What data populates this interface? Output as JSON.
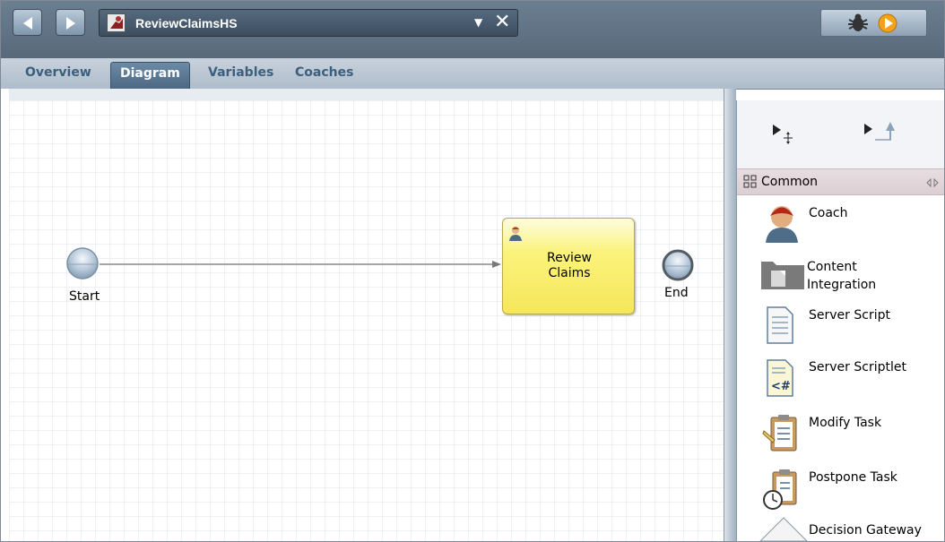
{
  "window": {
    "tab_title": "ReviewClaimsHS",
    "dropdown_glyph": "▼",
    "close_glyph": "✕",
    "back_icon": "arrow-left-icon",
    "forward_icon": "arrow-right-icon",
    "debug_icon": "bug-icon",
    "run_icon": "play-icon"
  },
  "tabs": [
    {
      "label": "Overview",
      "active": false
    },
    {
      "label": "Diagram",
      "active": true
    },
    {
      "label": "Variables",
      "active": false
    },
    {
      "label": "Coaches",
      "active": false
    }
  ],
  "diagram": {
    "start_label": "Start",
    "end_label": "End",
    "task_label_line1": "Review",
    "task_label_line2": "Claims",
    "task_icon": "user-icon"
  },
  "palette": {
    "tools": [
      "select-connect-tool",
      "sequence-flow-tool"
    ],
    "section_label": "Common",
    "items": [
      {
        "label": "Coach",
        "icon": "coach-user-icon"
      },
      {
        "label_line1": "Content",
        "label_line2": "Integration",
        "icon": "folder-document-icon"
      },
      {
        "label": "Server Script",
        "icon": "script-document-icon"
      },
      {
        "label": "Server Scriptlet",
        "icon": "scriptlet-document-icon"
      },
      {
        "label": "Modify Task",
        "icon": "clipboard-edit-icon"
      },
      {
        "label": "Postpone Task",
        "icon": "clipboard-clock-icon"
      },
      {
        "label": "Decision Gateway",
        "icon": "diamond-gateway-icon"
      }
    ]
  },
  "colors": {
    "titlebar": "#5f7386",
    "task_fill": "#fbf37c",
    "active_tab": "#5a7793",
    "palette_header": "#e3d8dc"
  }
}
